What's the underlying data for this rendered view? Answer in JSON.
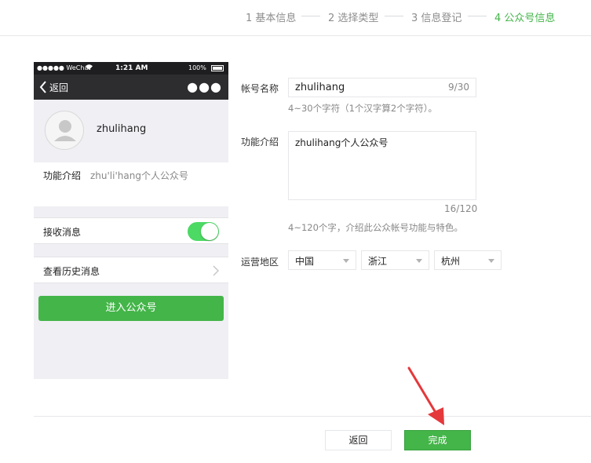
{
  "steps": [
    {
      "label": "1 基本信息",
      "active": false
    },
    {
      "label": "2 选择类型",
      "active": false
    },
    {
      "label": "3 信息登记",
      "active": false
    },
    {
      "label": "4 公众号信息",
      "active": true
    }
  ],
  "colors": {
    "accent": "#44b549",
    "toggle_on": "#4cd964",
    "arrow": "#e5383b"
  },
  "phone": {
    "status": {
      "carrier": "●●●●● WeChat",
      "time": "1:21 AM",
      "battery": "100%"
    },
    "nav": {
      "back_label": "返回",
      "more_icon": "more-icon"
    },
    "profile": {
      "name": "zhulihang",
      "avatar_icon": "default-user-icon"
    },
    "intro": {
      "label": "功能介绍",
      "value": "zhu'li'hang个人公众号"
    },
    "receive_messages": {
      "label": "接收消息",
      "enabled": true
    },
    "history": {
      "label": "查看历史消息"
    },
    "enter_button": "进入公众号"
  },
  "form": {
    "name": {
      "label": "帐号名称",
      "value": "zhulihang",
      "count": "9/30",
      "tip": "4~30个字符（1个汉字算2个字符）。"
    },
    "intro": {
      "label": "功能介绍",
      "value": "zhulihang个人公众号",
      "count": "16/120",
      "tip": "4~120个字，介绍此公众帐号功能与特色。"
    },
    "region": {
      "label": "运营地区",
      "country": "中国",
      "province": "浙江",
      "city": "杭州"
    }
  },
  "footer": {
    "back_button": "返回",
    "done_button": "完成"
  }
}
